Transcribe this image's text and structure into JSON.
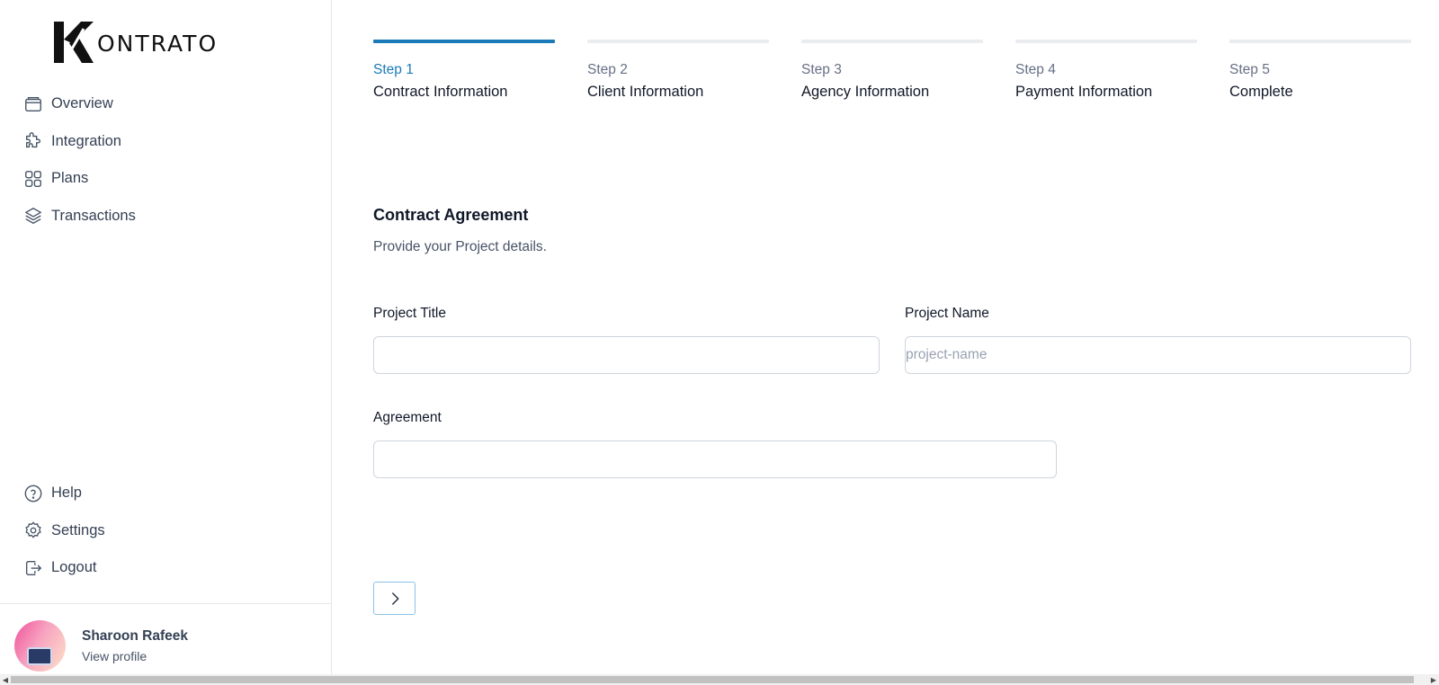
{
  "brand": {
    "logo_text": "ONTRATO",
    "logo_letter": "K"
  },
  "sidebar": {
    "top_items": [
      {
        "label": "Overview",
        "icon": "wallet-icon"
      },
      {
        "label": "Integration",
        "icon": "puzzle-icon"
      },
      {
        "label": "Plans",
        "icon": "grid-icon"
      },
      {
        "label": "Transactions",
        "icon": "layers-icon"
      }
    ],
    "bottom_items": [
      {
        "label": "Help",
        "icon": "help-icon"
      },
      {
        "label": "Settings",
        "icon": "gear-icon"
      },
      {
        "label": "Logout",
        "icon": "logout-icon"
      }
    ],
    "profile": {
      "name": "Sharoon Rafeek",
      "link": "View profile"
    }
  },
  "steps": [
    {
      "number": "Step 1",
      "name": "Contract Information",
      "active": true
    },
    {
      "number": "Step 2",
      "name": "Client Information",
      "active": false
    },
    {
      "number": "Step 3",
      "name": "Agency Information",
      "active": false
    },
    {
      "number": "Step 4",
      "name": "Payment Information",
      "active": false
    },
    {
      "number": "Step 5",
      "name": "Complete",
      "active": false
    }
  ],
  "form": {
    "title": "Contract Agreement",
    "subtitle": "Provide your Project details.",
    "project_title": {
      "label": "Project Title",
      "value": "",
      "placeholder": ""
    },
    "project_name": {
      "label": "Project Name",
      "value": "",
      "placeholder": "project-name"
    },
    "agreement": {
      "label": "Agreement",
      "value": "",
      "placeholder": ""
    }
  },
  "colors": {
    "accent": "#1b7ab8",
    "step_inactive": "#eaecf0",
    "next_border": "#8cc2e6"
  }
}
